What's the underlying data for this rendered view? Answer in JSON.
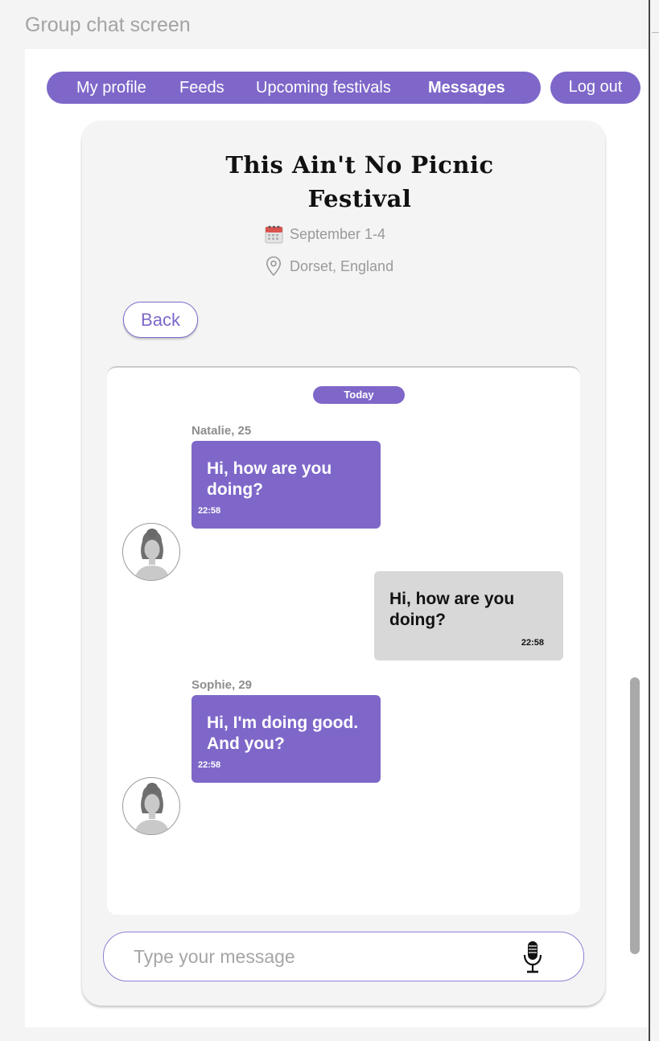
{
  "page": {
    "caption": "Group chat screen"
  },
  "nav": {
    "items": [
      {
        "label": "My profile"
      },
      {
        "label": "Feeds"
      },
      {
        "label": "Upcoming festivals"
      },
      {
        "label": "Messages",
        "active": true
      }
    ],
    "logout_label": "Log out"
  },
  "festival": {
    "title_line1": "This Ain't No Picnic",
    "title_line2": "Festival",
    "date": "September 1-4",
    "date_icon": "calendar-icon",
    "location": "Dorset, England",
    "location_icon": "location-pin-icon"
  },
  "back_label": "Back",
  "chat": {
    "day_badge": "Today",
    "messages": [
      {
        "sender": "Natalie, 25",
        "text": "Hi, how are you doing?",
        "time": "22:58",
        "direction": "incoming"
      },
      {
        "sender": "",
        "text": "Hi, how are you doing?",
        "time": "22:58",
        "direction": "outgoing"
      },
      {
        "sender": "Sophie, 29",
        "text": "Hi, I'm doing good. And you?",
        "time": "22:58",
        "direction": "incoming"
      }
    ]
  },
  "composer": {
    "placeholder": "Type your message",
    "value": "",
    "mic_icon": "microphone-icon"
  },
  "colors": {
    "accent": "#7e67c9",
    "outgoing_bubble": "#d8d8d8",
    "background": "#f4f4f4"
  }
}
